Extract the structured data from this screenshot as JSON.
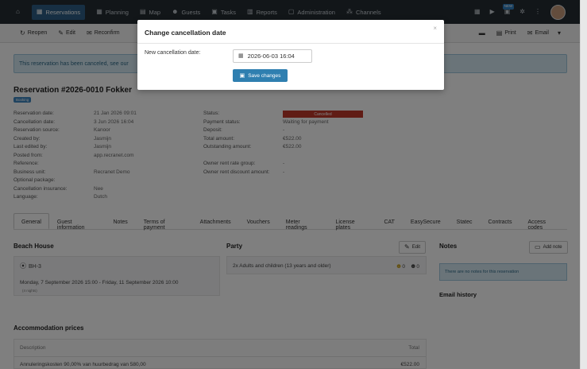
{
  "nav": {
    "items": [
      {
        "label": "Reservations",
        "icon": "calendar-icon"
      },
      {
        "label": "Planning",
        "icon": "calendar-icon"
      },
      {
        "label": "Map",
        "icon": "map-icon"
      },
      {
        "label": "Guests",
        "icon": "users-icon"
      },
      {
        "label": "Tasks",
        "icon": "clipboard-icon"
      },
      {
        "label": "Reports",
        "icon": "chart-icon"
      },
      {
        "label": "Administration",
        "icon": "document-icon"
      },
      {
        "label": "Channels",
        "icon": "network-icon"
      }
    ],
    "new_badge": "NEW"
  },
  "toolbar": {
    "reopen": "Reopen",
    "edit": "Edit",
    "reconfirm": "Reconfirm",
    "print": "Print",
    "email": "Email"
  },
  "alert": {
    "text": "This reservation has been canceled, see our"
  },
  "reservation": {
    "title": "Reservation #2026-0010 Fokker",
    "tag": "Booking",
    "left": [
      {
        "k": "Reservation date:",
        "v": "21 Jan 2026 09:01"
      },
      {
        "k": "Cancellation date:",
        "v": "3 Jun 2026 16:04"
      },
      {
        "k": "Reservation source:",
        "v": "Kanoor"
      },
      {
        "k": "Created by:",
        "v": "Jasmijn"
      },
      {
        "k": "Last edited by:",
        "v": "Jasmijn"
      },
      {
        "k": "Posted from:",
        "v": "app.recranet.com"
      },
      {
        "k": "Reference:",
        "v": ""
      },
      {
        "k": "Business unit:",
        "v": "Recranet Demo"
      },
      {
        "k": "Optional package:",
        "v": ""
      },
      {
        "k": "Cancellation insurance:",
        "v": "Nee"
      },
      {
        "k": "Language:",
        "v": "Dutch"
      }
    ],
    "right": [
      {
        "k": "Status:",
        "v": "Cancelled"
      },
      {
        "k": "Payment status:",
        "v": "Waiting for payment"
      },
      {
        "k": "Deposit:",
        "v": "-"
      },
      {
        "k": "Total amount:",
        "v": "€522.00"
      },
      {
        "k": "Outstanding amount:",
        "v": "€522.00"
      },
      {
        "k": "",
        "v": ""
      },
      {
        "k": "Owner rent rate group:",
        "v": "-"
      },
      {
        "k": "Owner rent discount amount:",
        "v": "-"
      }
    ]
  },
  "tabs": [
    "General",
    "Guest information",
    "Notes",
    "Terms of payment",
    "Attachments",
    "Vouchers",
    "Meter readings",
    "License plates",
    "CAT",
    "EasySecure",
    "Statec",
    "Contracts",
    "Access codes"
  ],
  "beach": {
    "title": "Beach House",
    "unit": "BH-3",
    "dates": "Monday, 7 September 2026 15:00  -  Friday, 11 September 2026 10:00",
    "nights": "(4 nights)"
  },
  "party": {
    "title": "Party",
    "edit": "Edit",
    "desc": "2x Adults and children (13 years and older)",
    "c1": "0",
    "c2": "0"
  },
  "notes": {
    "title": "Notes",
    "add": "Add note",
    "empty": "There are no notes for this reservation",
    "email_history": "Email history"
  },
  "prices": {
    "title": "Accommodation prices",
    "col_desc": "Description",
    "col_total": "Total",
    "row_desc": "Annuleringskosten 90,00% van huurbedrag van 580,00",
    "row_total": "€522.00"
  },
  "modal": {
    "title": "Change cancellation date",
    "label": "New cancellation date:",
    "value": "2026-06-03 16:04",
    "save": "Save changes",
    "close": "×"
  }
}
